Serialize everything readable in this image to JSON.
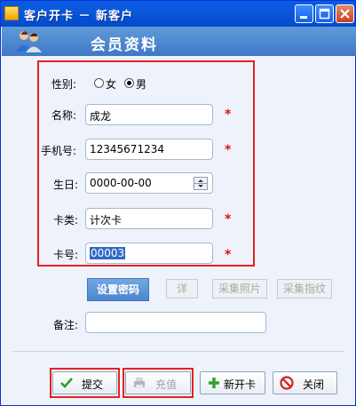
{
  "window": {
    "title": "客户开卡 － 新客户",
    "section_title": "会员资料"
  },
  "form": {
    "gender": {
      "label": "性别:",
      "options": [
        "女",
        "男"
      ],
      "selected": "男"
    },
    "name": {
      "label": "名称:",
      "value": "成龙"
    },
    "phone": {
      "label": "手机号:",
      "value": "12345671234"
    },
    "birthday": {
      "label": "生日:",
      "value": "0000-00-00"
    },
    "card_type": {
      "label": "卡类:",
      "value": "计次卡"
    },
    "card_no": {
      "label": "卡号:",
      "value": "00003"
    },
    "required_mark": "*",
    "remark": {
      "label": "备注:",
      "value": ""
    }
  },
  "actions": {
    "set_password": "设置密码",
    "detail": "详",
    "capture_photo": "采集照片",
    "capture_fingerprint": "采集指纹"
  },
  "footer": {
    "submit": "提交",
    "recharge": "充值",
    "new_card": "新开卡",
    "close": "关闭"
  },
  "colors": {
    "titlebar": "#0a5be2",
    "header_band": "#4f88d0",
    "highlight": "#e22222",
    "required": "#e01010"
  }
}
